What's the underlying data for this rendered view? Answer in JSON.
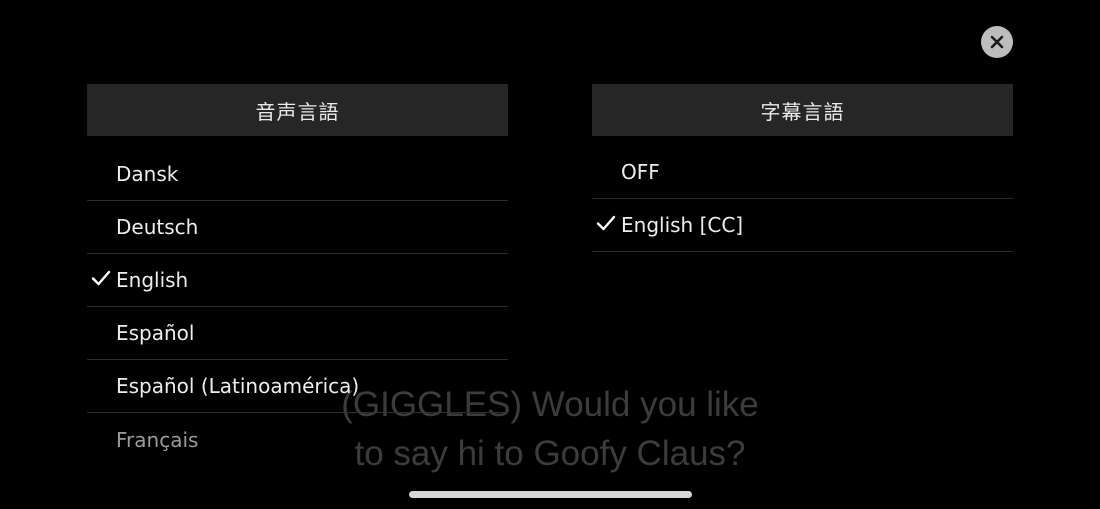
{
  "close_icon": "close-icon",
  "audio_panel": {
    "title": "音声言語",
    "options": [
      {
        "label": "Dansk",
        "selected": false
      },
      {
        "label": "Deutsch",
        "selected": false
      },
      {
        "label": "English",
        "selected": true
      },
      {
        "label": "Español",
        "selected": false
      },
      {
        "label": "Español (Latinoamérica)",
        "selected": false
      },
      {
        "label": "Français",
        "selected": false
      }
    ]
  },
  "subtitle_panel": {
    "title": "字幕言語",
    "options": [
      {
        "label": "OFF",
        "selected": false
      },
      {
        "label": "English [CC]",
        "selected": true
      }
    ]
  },
  "caption": {
    "line1": "(GIGGLES) Would you like",
    "line2": "to say hi to Goofy Claus?"
  },
  "colors": {
    "background": "#000000",
    "header_bg": "#262626",
    "close_button_bg": "#bdbdbd",
    "caption_text": "#3c3c3c"
  }
}
